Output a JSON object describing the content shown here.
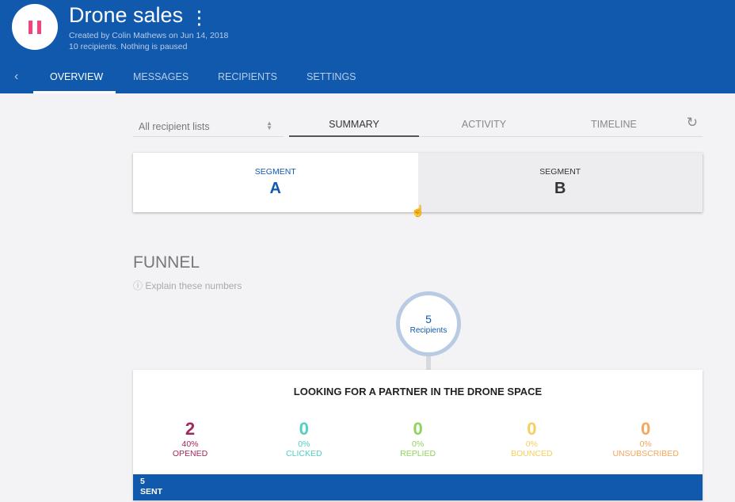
{
  "header": {
    "title": "Drone sales",
    "created": "Created by Colin Mathews on Jun 14, 2018",
    "status": "10 recipients. Nothing is paused",
    "menu_icon": "kebab-icon",
    "pause_color": "#f0457b",
    "bg": "#1059ad"
  },
  "nav": {
    "back": "‹",
    "tabs": [
      "OVERVIEW",
      "MESSAGES",
      "RECIPIENTS",
      "SETTINGS"
    ]
  },
  "filter": {
    "value": "All recipient lists"
  },
  "subtabs": [
    "SUMMARY",
    "ACTIVITY",
    "TIMELINE"
  ],
  "segments": [
    {
      "label": "SEGMENT",
      "value": "A"
    },
    {
      "label": "SEGMENT",
      "value": "B"
    }
  ],
  "funnel": {
    "title": "FUNNEL",
    "explain": "Explain these numbers",
    "recipients_count": "5",
    "recipients_label": "Recipients"
  },
  "message": {
    "title": "LOOKING FOR A PARTNER IN THE DRONE SPACE",
    "metrics": [
      {
        "n": "2",
        "p": "40%",
        "l": "OPENED",
        "color": "#a3275f"
      },
      {
        "n": "0",
        "p": "0%",
        "l": "CLICKED",
        "color": "#4fd0c0"
      },
      {
        "n": "0",
        "p": "0%",
        "l": "REPLIED",
        "color": "#8ed35a"
      },
      {
        "n": "0",
        "p": "0%",
        "l": "BOUNCED",
        "color": "#f8cf5a"
      },
      {
        "n": "0",
        "p": "0%",
        "l": "UNSUBSCRIBED",
        "color": "#f5a65a"
      }
    ],
    "sent_count": "5",
    "sent_label": "SENT"
  }
}
